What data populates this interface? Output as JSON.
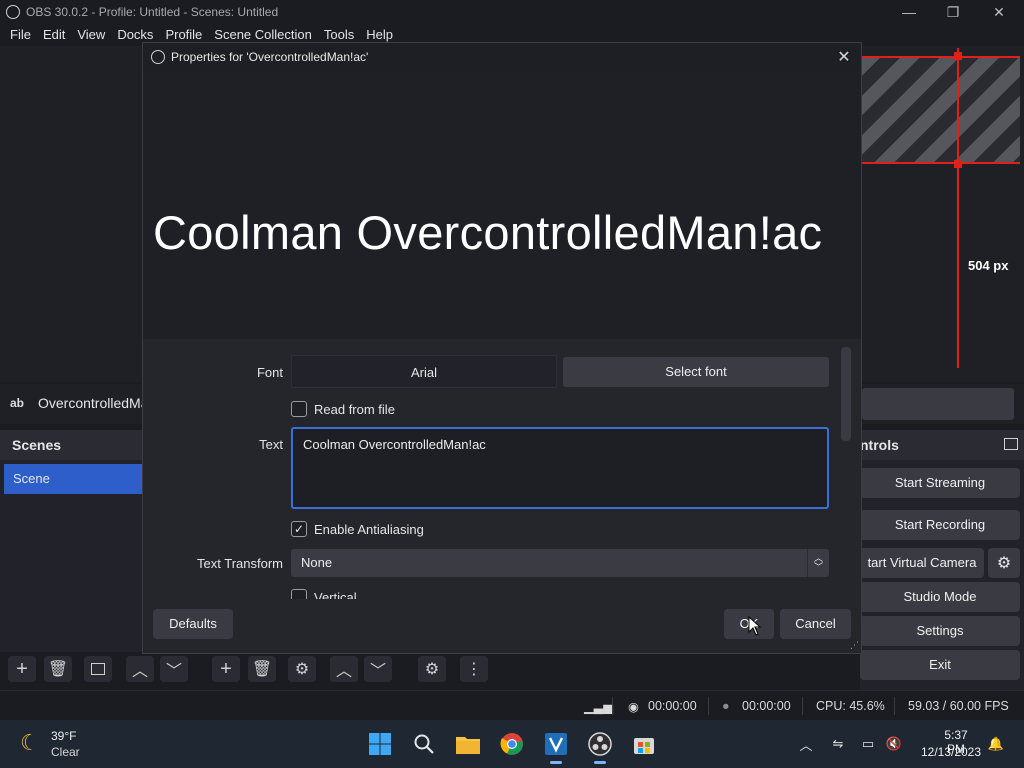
{
  "window": {
    "title": "OBS 30.0.2 - Profile: Untitled - Scenes: Untitled",
    "controls": {
      "minimize": "—",
      "maximize": "❐",
      "close": "✕"
    }
  },
  "menu": [
    "File",
    "Edit",
    "View",
    "Docks",
    "Profile",
    "Scene Collection",
    "Tools",
    "Help"
  ],
  "preview": {
    "dimension_label": "504 px"
  },
  "source_bar": {
    "type_icon": "ab",
    "source_name": "OvercontrolledMa"
  },
  "scenes": {
    "header": "Scenes",
    "items": [
      "Scene"
    ]
  },
  "controls": {
    "header": "ntrols",
    "buttons": [
      "Start Streaming",
      "Start Recording",
      "tart Virtual Camera",
      "Studio Mode",
      "Settings",
      "Exit"
    ]
  },
  "status": {
    "stream_time": "00:00:00",
    "record_time": "00:00:00",
    "cpu": "CPU: 45.6%",
    "fps": "59.03 / 60.00 FPS"
  },
  "dialog": {
    "title": "Properties for 'OvercontrolledMan!ac'",
    "preview_text": "Coolman OvercontrolledMan!ac",
    "font_label": "Font",
    "font_value": "Arial",
    "select_font": "Select font",
    "read_from_file": "Read from file",
    "read_from_file_checked": false,
    "text_label": "Text",
    "text_value": "Coolman OvercontrolledMan!ac",
    "antialiasing": "Enable Antialiasing",
    "antialiasing_checked": true,
    "transform_label": "Text Transform",
    "transform_value": "None",
    "vertical": "Vertical",
    "defaults": "Defaults",
    "ok": "OK",
    "cancel": "Cancel"
  },
  "taskbar": {
    "weather_temp": "39°F",
    "weather_cond": "Clear",
    "time": "5:37 PM",
    "date": "12/13/2023",
    "apps": [
      "start-icon",
      "search-icon",
      "file-explorer-icon",
      "chrome-icon",
      "vscode-icon",
      "obs-icon",
      "store-icon"
    ]
  }
}
